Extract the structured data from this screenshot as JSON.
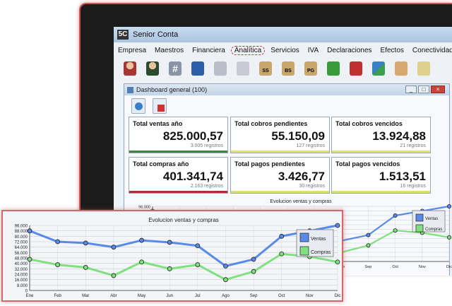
{
  "window": {
    "title": "Senior Conta",
    "logo": "5C"
  },
  "menu": [
    "Empresa",
    "Maestros",
    "Financiera",
    "Analítica",
    "Servicios",
    "IVA",
    "Declaraciones",
    "Efectos",
    "Conectividad"
  ],
  "active_menu": "Analítica",
  "toolbar_icons": [
    "users-icon",
    "user-icon",
    "hash-icon",
    "book-icon",
    "cards-icon",
    "coins-icon",
    "balance-ss-icon",
    "balance-bs-icon",
    "balance-pg-icon",
    "green-book-icon",
    "red-book-icon",
    "transfer-icon",
    "handshake-icon",
    "more-icon"
  ],
  "toolbar_labels": {
    "ss": "SS",
    "bs": "BS",
    "pg": "PG"
  },
  "dashboard": {
    "title": "Dashboard general (100)",
    "window_buttons": {
      "minimize": "_",
      "maximize": "□",
      "close": "×"
    }
  },
  "cards": [
    {
      "label": "Total ventas año",
      "value": "825.000,57",
      "sub": "3.005 registros",
      "bar": "#3a8c3a"
    },
    {
      "label": "Total cobros pendientes",
      "value": "55.150,09",
      "sub": "127 registros",
      "bar": "#e0e070"
    },
    {
      "label": "Total cobros vencidos",
      "value": "13.924,88",
      "sub": "21 registros",
      "bar": "#e0e070"
    },
    {
      "label": "Total compras año",
      "value": "401.341,74",
      "sub": "2.163 registros",
      "bar": "#b03030"
    },
    {
      "label": "Total pagos pendientes",
      "value": "3.426,77",
      "sub": "30 registros",
      "bar": "#e0e070"
    },
    {
      "label": "Total pagos vencidos",
      "value": "1.513,51",
      "sub": "16 registros",
      "bar": "#e0e070"
    }
  ],
  "chart_data": {
    "type": "line",
    "title": "Evolucion ventas y compras",
    "categories": [
      "Ene",
      "Feb",
      "Mar",
      "Abr",
      "May",
      "Jun",
      "Jul",
      "Ago",
      "Sep",
      "Oct",
      "Nov",
      "Dic"
    ],
    "ylim": [
      0,
      96000
    ],
    "yticks": [
      "0",
      "8.000",
      "16.000",
      "24.000",
      "32.000",
      "40.000",
      "48.000",
      "56.000",
      "64.000",
      "72.000",
      "80.000",
      "88.000",
      "96.000"
    ],
    "series": [
      {
        "name": "Ventas",
        "color": "#5a8ae8",
        "values": [
          88000,
          72000,
          70000,
          64000,
          74000,
          71000,
          66000,
          36000,
          46000,
          80000,
          88000,
          96000
        ]
      },
      {
        "name": "Compras",
        "color": "#80e080",
        "values": [
          46000,
          38000,
          34000,
          22000,
          42000,
          32000,
          38000,
          16000,
          28000,
          54000,
          50000,
          42000
        ]
      }
    ],
    "legend_position": "top-right",
    "grid": true
  }
}
